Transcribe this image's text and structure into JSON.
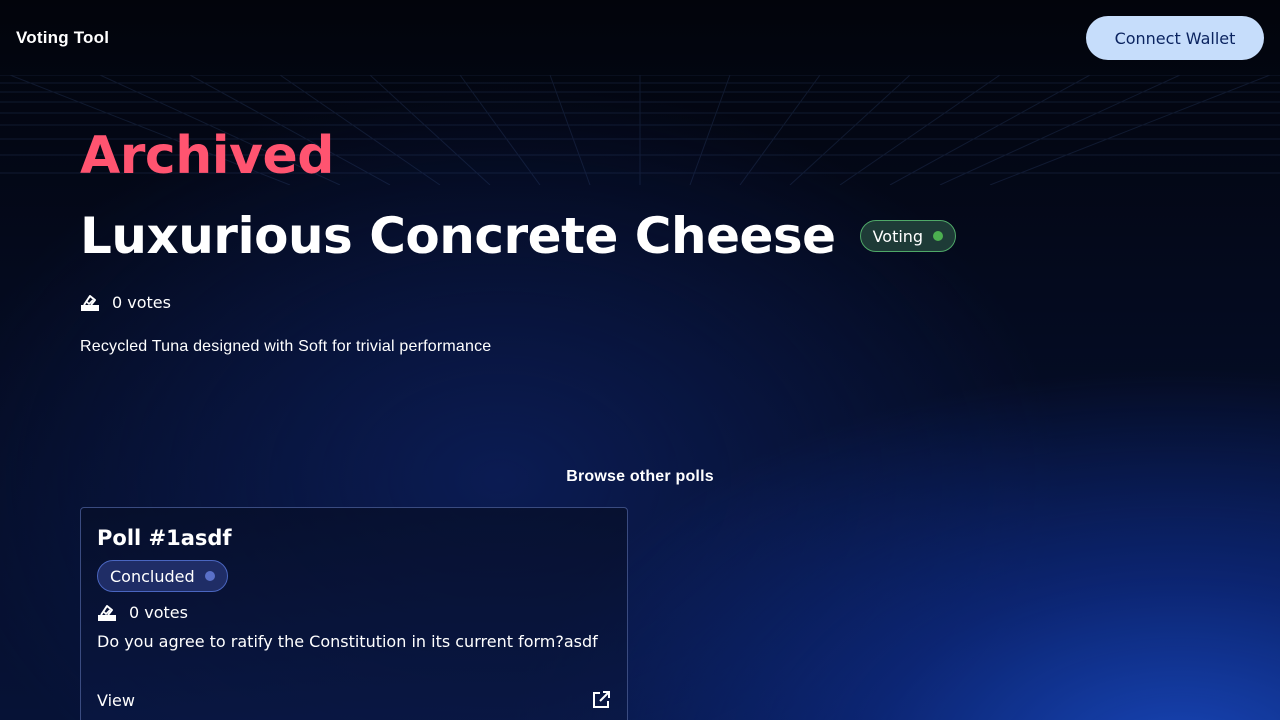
{
  "header": {
    "app_title": "Voting Tool",
    "connect_label": "Connect Wallet"
  },
  "poll": {
    "archived_label": "Archived",
    "title": "Luxurious Concrete Cheese",
    "status": "Voting",
    "votes": "0 votes",
    "description": "Recycled Tuna designed with Soft for trivial performance"
  },
  "browse": {
    "heading": "Browse other polls",
    "cards": [
      {
        "title": "Poll #1asdf",
        "status": "Concluded",
        "votes": "0 votes",
        "description": "Do you agree to ratify the Constitution in its current form?asdf",
        "view_label": "View"
      }
    ]
  },
  "colors": {
    "archived": "#ff5470",
    "voting_dot": "#4caf50",
    "concluded_dot": "#5a70c8",
    "connect_button": "#c6ddfb"
  },
  "icons": {
    "votes": "ballot-box-icon",
    "view": "external-link-icon"
  }
}
